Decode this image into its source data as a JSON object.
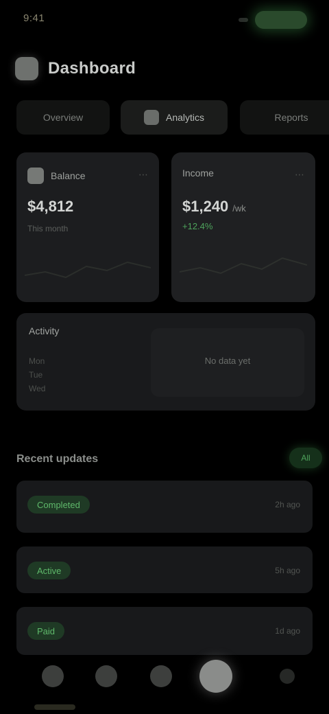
{
  "status": {
    "time": "9:41"
  },
  "header": {
    "title": "Dashboard"
  },
  "tabs": [
    {
      "label": "Overview"
    },
    {
      "label": "Analytics"
    },
    {
      "label": "Reports"
    }
  ],
  "cards": {
    "a": {
      "label": "Balance",
      "value": "$4,812",
      "sub": "This month",
      "menu": "⋯"
    },
    "b": {
      "label": "Income",
      "value": "$1,240",
      "unit": "/wk",
      "change": "+12.4%",
      "menu": "⋯"
    }
  },
  "wide": {
    "label": "Activity",
    "side": [
      "Mon",
      "Tue",
      "Wed"
    ],
    "panel_text": "No data yet"
  },
  "section": {
    "title": "Recent updates",
    "action": "All"
  },
  "rows": [
    {
      "badge": "Completed",
      "meta": "2h ago"
    },
    {
      "badge": "Active",
      "meta": "5h ago"
    },
    {
      "badge": "Paid",
      "meta": "1d ago"
    }
  ],
  "nav": [
    {
      "name": "home"
    },
    {
      "name": "search"
    },
    {
      "name": "wallet"
    },
    {
      "name": "profile"
    },
    {
      "name": "more"
    }
  ],
  "colors": {
    "accent": "#4ea35c",
    "background": "#000000",
    "card": "#1c1d1f"
  }
}
